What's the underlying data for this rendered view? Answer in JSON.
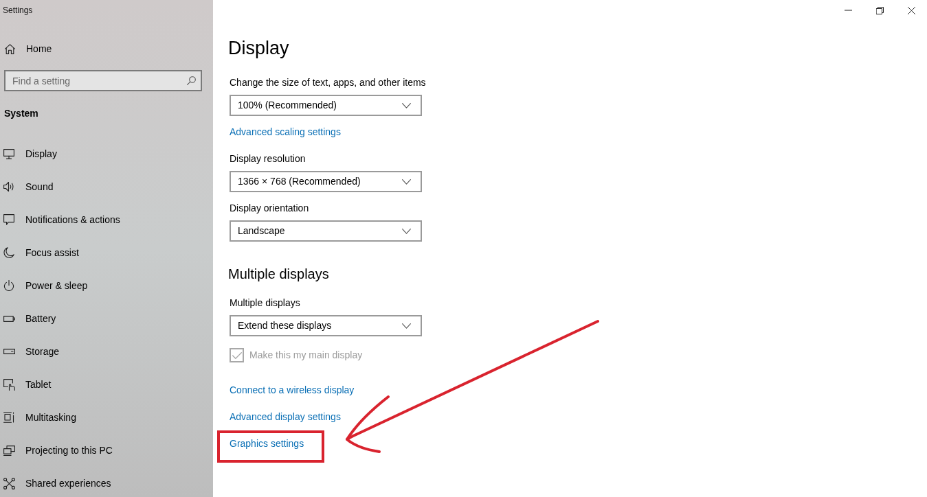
{
  "window": {
    "title": "Settings"
  },
  "sidebar": {
    "home": "Home",
    "search": {
      "placeholder": "Find a setting"
    },
    "section": "System",
    "items": [
      {
        "label": "Display"
      },
      {
        "label": "Sound"
      },
      {
        "label": "Notifications & actions"
      },
      {
        "label": "Focus assist"
      },
      {
        "label": "Power & sleep"
      },
      {
        "label": "Battery"
      },
      {
        "label": "Storage"
      },
      {
        "label": "Tablet"
      },
      {
        "label": "Multitasking"
      },
      {
        "label": "Projecting to this PC"
      },
      {
        "label": "Shared experiences"
      }
    ]
  },
  "content": {
    "title": "Display",
    "scale": {
      "label": "Change the size of text, apps, and other items",
      "value": "100% (Recommended)"
    },
    "scale_link": "Advanced scaling settings",
    "resolution": {
      "label": "Display resolution",
      "value": "1366 × 768 (Recommended)"
    },
    "orientation": {
      "label": "Display orientation",
      "value": "Landscape"
    }
  },
  "multiple_displays": {
    "heading": "Multiple displays",
    "mode": {
      "label": "Multiple displays",
      "value": "Extend these displays"
    },
    "main_display": {
      "label": "Make this my main display",
      "checked": true,
      "disabled": true
    },
    "links": [
      {
        "label": "Connect to a wireless display",
        "highlighted": false
      },
      {
        "label": "Advanced display settings",
        "highlighted": false
      },
      {
        "label": "Graphics settings",
        "highlighted": true
      }
    ]
  }
}
